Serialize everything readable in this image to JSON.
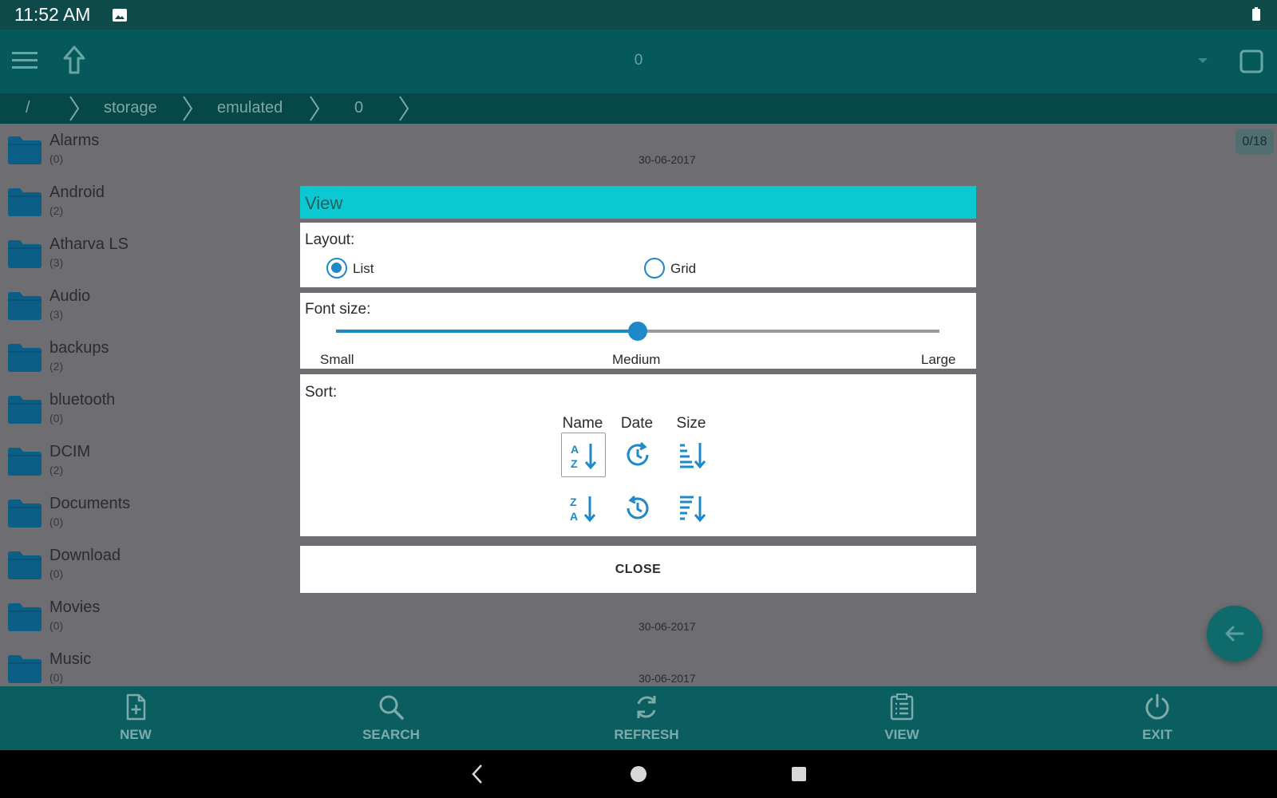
{
  "status": {
    "time": "11:52 AM"
  },
  "toolbar": {
    "title": "0"
  },
  "breadcrumb": [
    "/",
    "storage",
    "emulated",
    "0"
  ],
  "counter": "0/18",
  "files": [
    {
      "name": "Alarms",
      "count": "(0)",
      "date": "30-06-2017"
    },
    {
      "name": "Android",
      "count": "(2)",
      "date": ""
    },
    {
      "name": "Atharva LS",
      "count": "(3)",
      "date": ""
    },
    {
      "name": "Audio",
      "count": "(3)",
      "date": ""
    },
    {
      "name": "backups",
      "count": "(2)",
      "date": ""
    },
    {
      "name": "bluetooth",
      "count": "(0)",
      "date": ""
    },
    {
      "name": "DCIM",
      "count": "(2)",
      "date": ""
    },
    {
      "name": "Documents",
      "count": "(0)",
      "date": ""
    },
    {
      "name": "Download",
      "count": "(0)",
      "date": ""
    },
    {
      "name": "Movies",
      "count": "(0)",
      "date": "30-06-2017"
    },
    {
      "name": "Music",
      "count": "(0)",
      "date": "30-06-2017"
    }
  ],
  "bottom_bar": [
    {
      "label": "NEW",
      "icon": "new-file-icon"
    },
    {
      "label": "SEARCH",
      "icon": "search-icon"
    },
    {
      "label": "REFRESH",
      "icon": "refresh-icon"
    },
    {
      "label": "VIEW",
      "icon": "view-icon"
    },
    {
      "label": "EXIT",
      "icon": "power-icon"
    }
  ],
  "dialog": {
    "title": "View",
    "layout": {
      "label": "Layout:",
      "options": [
        "List",
        "Grid"
      ],
      "selected": "List"
    },
    "font_size": {
      "label": "Font size:",
      "ticks": [
        "Small",
        "Medium",
        "Large"
      ],
      "value": "Medium",
      "fraction": 0.5
    },
    "sort": {
      "label": "Sort:",
      "columns": [
        "Name",
        "Date",
        "Size"
      ],
      "selected": "name-ascending"
    },
    "close_label": "CLOSE"
  },
  "colors": {
    "accent": "#1e88c8",
    "dialog_header": "#0cc8d1",
    "toolbar": "#05595a",
    "folder": "#0b5f86"
  }
}
